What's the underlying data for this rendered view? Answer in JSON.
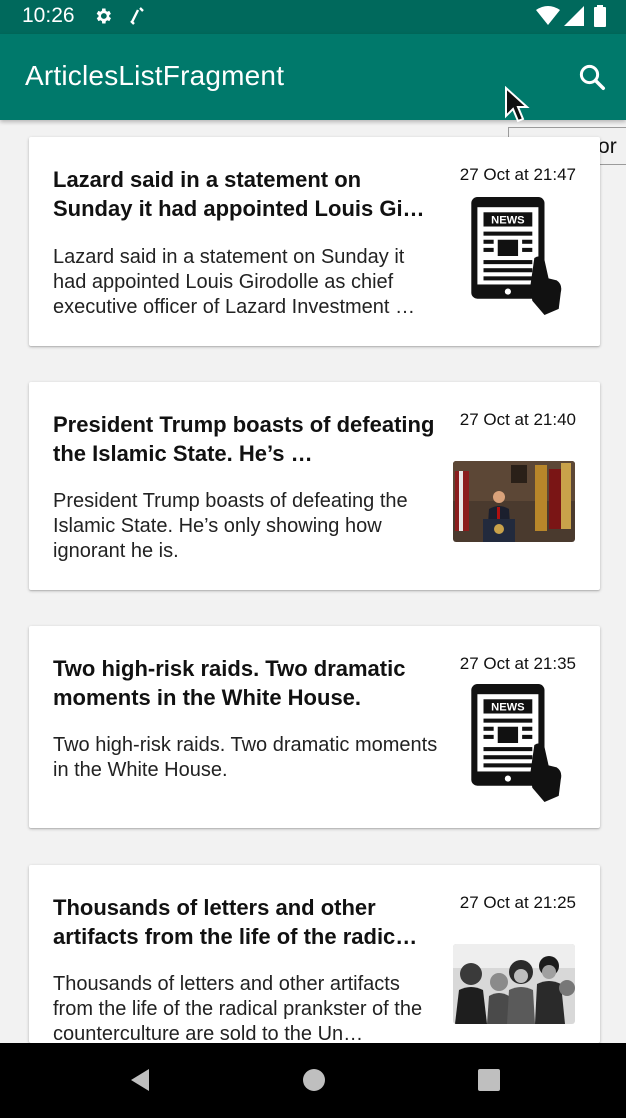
{
  "status_bar": {
    "time": "10:26"
  },
  "app_bar": {
    "title": "ArticlesListFragment"
  },
  "tooltip": {
    "text": "New recor"
  },
  "articles": [
    {
      "headline": "Lazard said in a statement on Sunday it had appointed Louis Gi…",
      "date": "27 Oct at 21:47",
      "summary": "Lazard said in a statement on Sunday it had appointed Louis Girodolle as chief executive officer of Lazard Investment …",
      "image": "news-tablet-icon"
    },
    {
      "headline": "President Trump boasts of defeating the Islamic State. He’s …",
      "date": "27 Oct at 21:40",
      "summary": "President Trump boasts of defeating the Islamic State. He’s only showing how ignorant he is.",
      "image": "press-conference-photo"
    },
    {
      "headline": "Two high-risk raids. Two dramatic moments in the White House.",
      "date": "27 Oct at 21:35",
      "summary": "Two high-risk raids. Two dramatic moments in the White House.",
      "image": "news-tablet-icon"
    },
    {
      "headline": "Thousands of letters and other artifacts from the life of the radic…",
      "date": "27 Oct at 21:25",
      "summary": "Thousands of letters and other artifacts from the life of the radical prankster of the counterculture are sold to the Un…",
      "image": "crowd-bw-photo"
    }
  ],
  "colors": {
    "status_bar": "#00695c",
    "app_bar": "#00796b",
    "background": "#f2f2f2"
  }
}
